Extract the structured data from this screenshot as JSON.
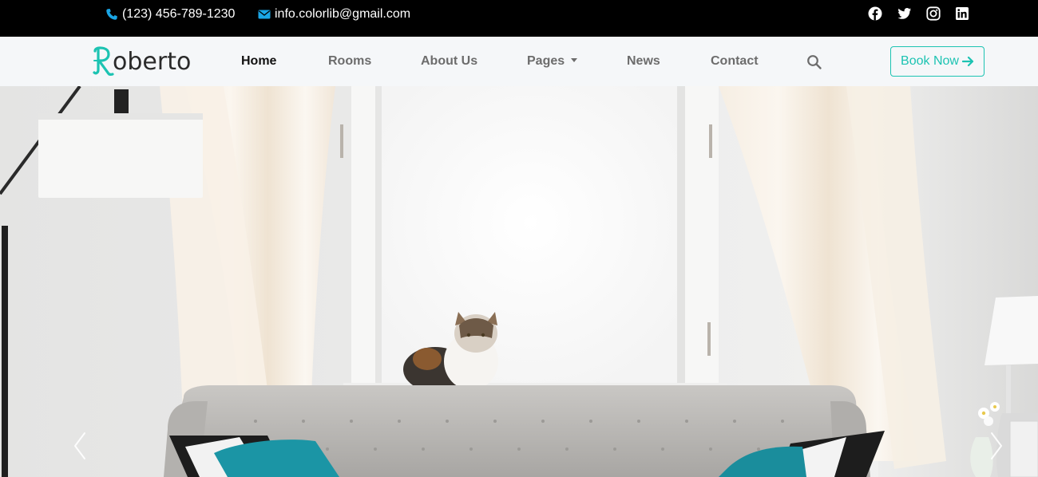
{
  "topbar": {
    "phone": "(123) 456-789-1230",
    "email": "info.colorlib@gmail.com",
    "social": [
      "facebook-icon",
      "twitter-icon",
      "instagram-icon",
      "linkedin-icon"
    ]
  },
  "brand": {
    "name": "oberto",
    "initial": "R"
  },
  "nav": {
    "items": [
      {
        "label": "Home",
        "active": true
      },
      {
        "label": "Rooms"
      },
      {
        "label": "About Us"
      },
      {
        "label": "Pages",
        "dropdown": true
      },
      {
        "label": "News"
      },
      {
        "label": "Contact"
      }
    ],
    "search_icon": "search-icon",
    "book_button": "Book Now",
    "book_icon": "arrow-right-icon"
  },
  "hero": {
    "prev_icon": "chevron-left-icon",
    "next_icon": "chevron-right-icon"
  },
  "colors": {
    "accent": "#1cc3b2",
    "topbar_bg": "#000000",
    "nav_bg": "#f5f7f9",
    "icon_blue": "#1aa6e6"
  }
}
